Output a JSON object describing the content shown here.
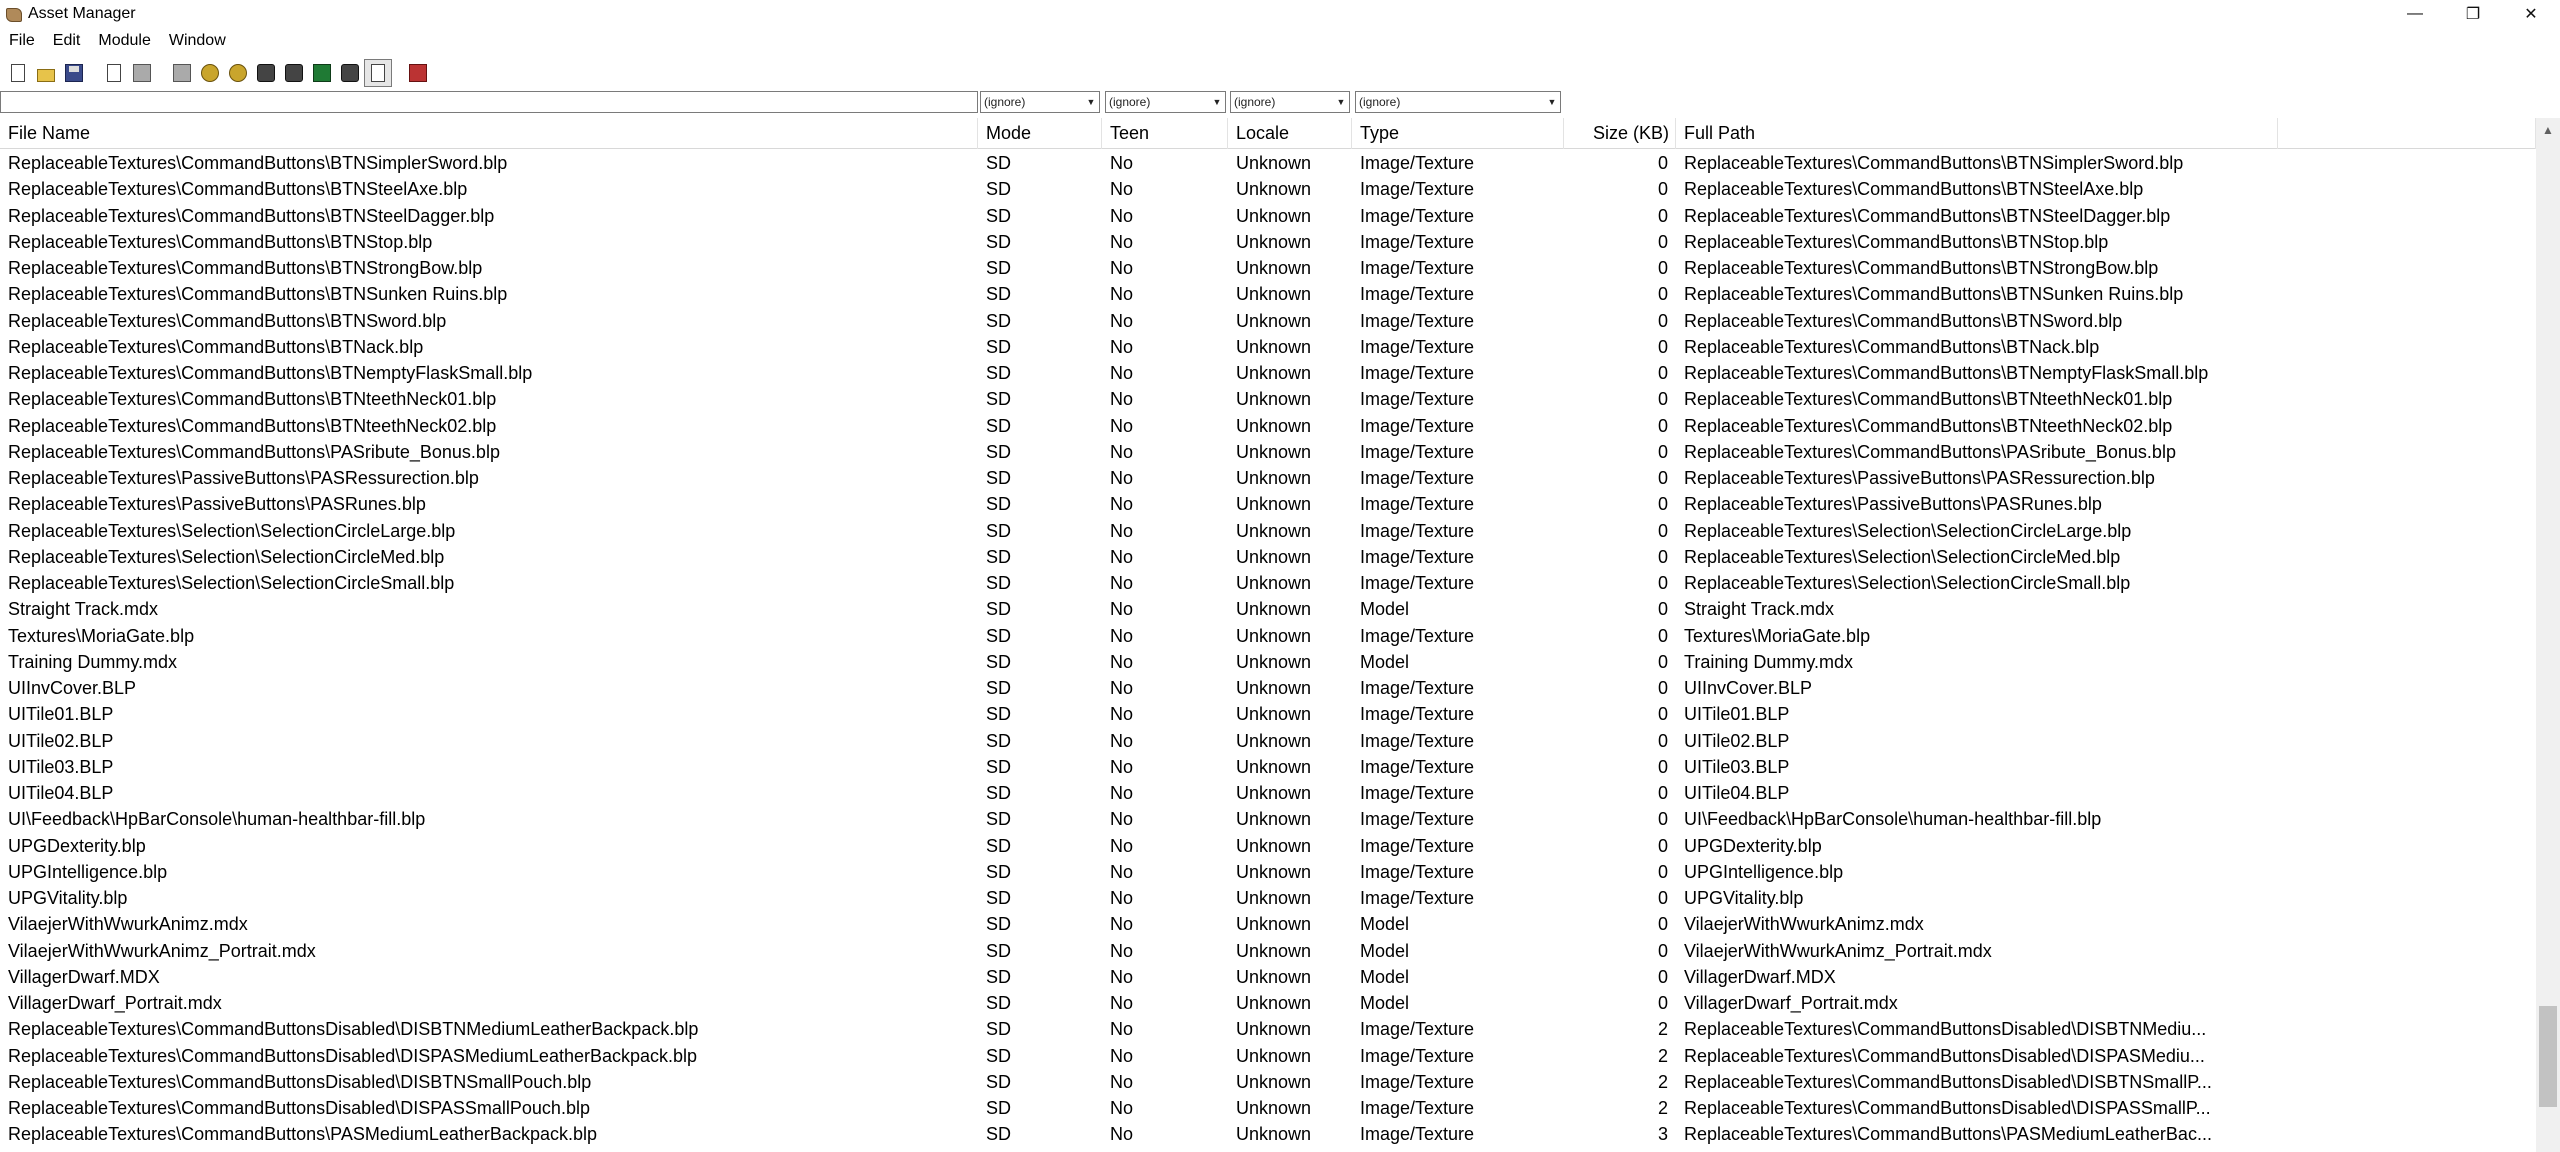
{
  "window": {
    "title": "Asset Manager",
    "controls": {
      "minimize": "—",
      "maximize": "❐",
      "close": "✕"
    }
  },
  "menu": [
    "File",
    "Edit",
    "Module",
    "Window"
  ],
  "toolbar": {
    "buttons": [
      {
        "name": "new-icon",
        "style": "ico-page"
      },
      {
        "name": "open-icon",
        "style": "ico-folder"
      },
      {
        "name": "save-icon",
        "style": "ico-disk"
      },
      {
        "name": "sep"
      },
      {
        "name": "export-icon",
        "style": "ico-page"
      },
      {
        "name": "copy-icon",
        "style": "ico-grey"
      },
      {
        "name": "sep"
      },
      {
        "name": "model-icon",
        "style": "ico-grey"
      },
      {
        "name": "texture-icon",
        "style": "ico-gold"
      },
      {
        "name": "sound-icon",
        "style": "ico-gold"
      },
      {
        "name": "script-icon",
        "style": "ico-dark"
      },
      {
        "name": "keyboard-icon",
        "style": "ico-dark"
      },
      {
        "name": "minimap-icon",
        "style": "ico-green"
      },
      {
        "name": "terrain-icon",
        "style": "ico-dark"
      },
      {
        "name": "asset-list-icon",
        "style": "ico-page",
        "pressed": true
      },
      {
        "name": "sep"
      },
      {
        "name": "import-icon",
        "style": "ico-red"
      }
    ]
  },
  "filters": {
    "search_value": "",
    "mode": "(ignore)",
    "teen": "(ignore)",
    "locale": "(ignore)",
    "type": "(ignore)"
  },
  "columns": {
    "file": "File Name",
    "mode": "Mode",
    "teen": "Teen",
    "locale": "Locale",
    "type": "Type",
    "size": "Size (KB)",
    "path": "Full Path"
  },
  "rows": [
    {
      "file": "ReplaceableTextures\\CommandButtons\\BTNSimplerSword.blp",
      "mode": "SD",
      "teen": "No",
      "locale": "Unknown",
      "type": "Image/Texture",
      "size": "0",
      "path": "ReplaceableTextures\\CommandButtons\\BTNSimplerSword.blp"
    },
    {
      "file": "ReplaceableTextures\\CommandButtons\\BTNSteelAxe.blp",
      "mode": "SD",
      "teen": "No",
      "locale": "Unknown",
      "type": "Image/Texture",
      "size": "0",
      "path": "ReplaceableTextures\\CommandButtons\\BTNSteelAxe.blp"
    },
    {
      "file": "ReplaceableTextures\\CommandButtons\\BTNSteelDagger.blp",
      "mode": "SD",
      "teen": "No",
      "locale": "Unknown",
      "type": "Image/Texture",
      "size": "0",
      "path": "ReplaceableTextures\\CommandButtons\\BTNSteelDagger.blp"
    },
    {
      "file": "ReplaceableTextures\\CommandButtons\\BTNStop.blp",
      "mode": "SD",
      "teen": "No",
      "locale": "Unknown",
      "type": "Image/Texture",
      "size": "0",
      "path": "ReplaceableTextures\\CommandButtons\\BTNStop.blp"
    },
    {
      "file": "ReplaceableTextures\\CommandButtons\\BTNStrongBow.blp",
      "mode": "SD",
      "teen": "No",
      "locale": "Unknown",
      "type": "Image/Texture",
      "size": "0",
      "path": "ReplaceableTextures\\CommandButtons\\BTNStrongBow.blp"
    },
    {
      "file": "ReplaceableTextures\\CommandButtons\\BTNSunken Ruins.blp",
      "mode": "SD",
      "teen": "No",
      "locale": "Unknown",
      "type": "Image/Texture",
      "size": "0",
      "path": "ReplaceableTextures\\CommandButtons\\BTNSunken Ruins.blp"
    },
    {
      "file": "ReplaceableTextures\\CommandButtons\\BTNSword.blp",
      "mode": "SD",
      "teen": "No",
      "locale": "Unknown",
      "type": "Image/Texture",
      "size": "0",
      "path": "ReplaceableTextures\\CommandButtons\\BTNSword.blp"
    },
    {
      "file": "ReplaceableTextures\\CommandButtons\\BTNack.blp",
      "mode": "SD",
      "teen": "No",
      "locale": "Unknown",
      "type": "Image/Texture",
      "size": "0",
      "path": "ReplaceableTextures\\CommandButtons\\BTNack.blp"
    },
    {
      "file": "ReplaceableTextures\\CommandButtons\\BTNemptyFlaskSmall.blp",
      "mode": "SD",
      "teen": "No",
      "locale": "Unknown",
      "type": "Image/Texture",
      "size": "0",
      "path": "ReplaceableTextures\\CommandButtons\\BTNemptyFlaskSmall.blp"
    },
    {
      "file": "ReplaceableTextures\\CommandButtons\\BTNteethNeck01.blp",
      "mode": "SD",
      "teen": "No",
      "locale": "Unknown",
      "type": "Image/Texture",
      "size": "0",
      "path": "ReplaceableTextures\\CommandButtons\\BTNteethNeck01.blp"
    },
    {
      "file": "ReplaceableTextures\\CommandButtons\\BTNteethNeck02.blp",
      "mode": "SD",
      "teen": "No",
      "locale": "Unknown",
      "type": "Image/Texture",
      "size": "0",
      "path": "ReplaceableTextures\\CommandButtons\\BTNteethNeck02.blp"
    },
    {
      "file": "ReplaceableTextures\\CommandButtons\\PASribute_Bonus.blp",
      "mode": "SD",
      "teen": "No",
      "locale": "Unknown",
      "type": "Image/Texture",
      "size": "0",
      "path": "ReplaceableTextures\\CommandButtons\\PASribute_Bonus.blp"
    },
    {
      "file": "ReplaceableTextures\\PassiveButtons\\PASRessurection.blp",
      "mode": "SD",
      "teen": "No",
      "locale": "Unknown",
      "type": "Image/Texture",
      "size": "0",
      "path": "ReplaceableTextures\\PassiveButtons\\PASRessurection.blp"
    },
    {
      "file": "ReplaceableTextures\\PassiveButtons\\PASRunes.blp",
      "mode": "SD",
      "teen": "No",
      "locale": "Unknown",
      "type": "Image/Texture",
      "size": "0",
      "path": "ReplaceableTextures\\PassiveButtons\\PASRunes.blp"
    },
    {
      "file": "ReplaceableTextures\\Selection\\SelectionCircleLarge.blp",
      "mode": "SD",
      "teen": "No",
      "locale": "Unknown",
      "type": "Image/Texture",
      "size": "0",
      "path": "ReplaceableTextures\\Selection\\SelectionCircleLarge.blp"
    },
    {
      "file": "ReplaceableTextures\\Selection\\SelectionCircleMed.blp",
      "mode": "SD",
      "teen": "No",
      "locale": "Unknown",
      "type": "Image/Texture",
      "size": "0",
      "path": "ReplaceableTextures\\Selection\\SelectionCircleMed.blp"
    },
    {
      "file": "ReplaceableTextures\\Selection\\SelectionCircleSmall.blp",
      "mode": "SD",
      "teen": "No",
      "locale": "Unknown",
      "type": "Image/Texture",
      "size": "0",
      "path": "ReplaceableTextures\\Selection\\SelectionCircleSmall.blp"
    },
    {
      "file": "Straight Track.mdx",
      "mode": "SD",
      "teen": "No",
      "locale": "Unknown",
      "type": "Model",
      "size": "0",
      "path": "Straight Track.mdx"
    },
    {
      "file": "Textures\\MoriaGate.blp",
      "mode": "SD",
      "teen": "No",
      "locale": "Unknown",
      "type": "Image/Texture",
      "size": "0",
      "path": "Textures\\MoriaGate.blp"
    },
    {
      "file": "Training Dummy.mdx",
      "mode": "SD",
      "teen": "No",
      "locale": "Unknown",
      "type": "Model",
      "size": "0",
      "path": "Training Dummy.mdx"
    },
    {
      "file": "UIInvCover.BLP",
      "mode": "SD",
      "teen": "No",
      "locale": "Unknown",
      "type": "Image/Texture",
      "size": "0",
      "path": "UIInvCover.BLP"
    },
    {
      "file": "UITile01.BLP",
      "mode": "SD",
      "teen": "No",
      "locale": "Unknown",
      "type": "Image/Texture",
      "size": "0",
      "path": "UITile01.BLP"
    },
    {
      "file": "UITile02.BLP",
      "mode": "SD",
      "teen": "No",
      "locale": "Unknown",
      "type": "Image/Texture",
      "size": "0",
      "path": "UITile02.BLP"
    },
    {
      "file": "UITile03.BLP",
      "mode": "SD",
      "teen": "No",
      "locale": "Unknown",
      "type": "Image/Texture",
      "size": "0",
      "path": "UITile03.BLP"
    },
    {
      "file": "UITile04.BLP",
      "mode": "SD",
      "teen": "No",
      "locale": "Unknown",
      "type": "Image/Texture",
      "size": "0",
      "path": "UITile04.BLP"
    },
    {
      "file": "UI\\Feedback\\HpBarConsole\\human-healthbar-fill.blp",
      "mode": "SD",
      "teen": "No",
      "locale": "Unknown",
      "type": "Image/Texture",
      "size": "0",
      "path": "UI\\Feedback\\HpBarConsole\\human-healthbar-fill.blp"
    },
    {
      "file": "UPGDexterity.blp",
      "mode": "SD",
      "teen": "No",
      "locale": "Unknown",
      "type": "Image/Texture",
      "size": "0",
      "path": "UPGDexterity.blp"
    },
    {
      "file": "UPGIntelligence.blp",
      "mode": "SD",
      "teen": "No",
      "locale": "Unknown",
      "type": "Image/Texture",
      "size": "0",
      "path": "UPGIntelligence.blp"
    },
    {
      "file": "UPGVitality.blp",
      "mode": "SD",
      "teen": "No",
      "locale": "Unknown",
      "type": "Image/Texture",
      "size": "0",
      "path": "UPGVitality.blp"
    },
    {
      "file": "VilaejerWithWwurkAnimz.mdx",
      "mode": "SD",
      "teen": "No",
      "locale": "Unknown",
      "type": "Model",
      "size": "0",
      "path": "VilaejerWithWwurkAnimz.mdx"
    },
    {
      "file": "VilaejerWithWwurkAnimz_Portrait.mdx",
      "mode": "SD",
      "teen": "No",
      "locale": "Unknown",
      "type": "Model",
      "size": "0",
      "path": "VilaejerWithWwurkAnimz_Portrait.mdx"
    },
    {
      "file": "VillagerDwarf.MDX",
      "mode": "SD",
      "teen": "No",
      "locale": "Unknown",
      "type": "Model",
      "size": "0",
      "path": "VillagerDwarf.MDX"
    },
    {
      "file": "VillagerDwarf_Portrait.mdx",
      "mode": "SD",
      "teen": "No",
      "locale": "Unknown",
      "type": "Model",
      "size": "0",
      "path": "VillagerDwarf_Portrait.mdx"
    },
    {
      "file": "ReplaceableTextures\\CommandButtonsDisabled\\DISBTNMediumLeatherBackpack.blp",
      "mode": "SD",
      "teen": "No",
      "locale": "Unknown",
      "type": "Image/Texture",
      "size": "2",
      "path": "ReplaceableTextures\\CommandButtonsDisabled\\DISBTNMediu..."
    },
    {
      "file": "ReplaceableTextures\\CommandButtonsDisabled\\DISPASMediumLeatherBackpack.blp",
      "mode": "SD",
      "teen": "No",
      "locale": "Unknown",
      "type": "Image/Texture",
      "size": "2",
      "path": "ReplaceableTextures\\CommandButtonsDisabled\\DISPASMediu..."
    },
    {
      "file": "ReplaceableTextures\\CommandButtonsDisabled\\DISBTNSmallPouch.blp",
      "mode": "SD",
      "teen": "No",
      "locale": "Unknown",
      "type": "Image/Texture",
      "size": "2",
      "path": "ReplaceableTextures\\CommandButtonsDisabled\\DISBTNSmallP..."
    },
    {
      "file": "ReplaceableTextures\\CommandButtonsDisabled\\DISPASSmallPouch.blp",
      "mode": "SD",
      "teen": "No",
      "locale": "Unknown",
      "type": "Image/Texture",
      "size": "2",
      "path": "ReplaceableTextures\\CommandButtonsDisabled\\DISPASSmallP..."
    },
    {
      "file": "ReplaceableTextures\\CommandButtons\\PASMediumLeatherBackpack.blp",
      "mode": "SD",
      "teen": "No",
      "locale": "Unknown",
      "type": "Image/Texture",
      "size": "3",
      "path": "ReplaceableTextures\\CommandButtons\\PASMediumLeatherBac..."
    }
  ],
  "scrollbar": {
    "up_arrow": "▲",
    "position": 0.95,
    "visible_fraction": 0.1
  }
}
